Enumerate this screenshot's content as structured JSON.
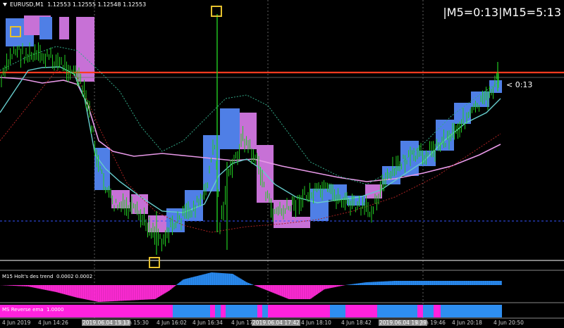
{
  "header": {
    "symbol": "EURUSD,M1",
    "ohlc": "1.12553 1.12555 1.12548 1.12553",
    "timer_text": "|M5=0:13|M15=5:13",
    "price_tag": "< 0:13"
  },
  "indicators": {
    "holt_label": "M15 Holt's des trend",
    "holt_values": "0.0002 0.0002",
    "reverse_label": "MS Reverse ema",
    "reverse_value": "1.0000"
  },
  "time_axis": [
    {
      "label": "4 Jun 2019",
      "highlight": false
    },
    {
      "label": "4 Jun 14:26",
      "highlight": false
    },
    {
      "label": "2019.06.04 15:13",
      "highlight": true
    },
    {
      "label": "4 Jun 15:30",
      "highlight": false
    },
    {
      "label": "4 Jun 16:02",
      "highlight": false
    },
    {
      "label": "4 Jun 16:34",
      "highlight": false
    },
    {
      "label": "4 Jun 17",
      "highlight": false
    },
    {
      "label": "2019.06.04 17:42",
      "highlight": true
    },
    {
      "label": "4 Jun 18:10",
      "highlight": false
    },
    {
      "label": "4 Jun 18:42",
      "highlight": false
    },
    {
      "label": "2019.06.04 19:29",
      "highlight": true
    },
    {
      "label": "4 Jun 19:46",
      "highlight": false
    },
    {
      "label": "4 Jun 20:18",
      "highlight": false
    },
    {
      "label": "4 Jun 20:50",
      "highlight": false
    }
  ],
  "colors": {
    "background": "#000000",
    "candle": "#22cc22",
    "box_up": "#4f7fe6",
    "box_down": "#c771d6",
    "fast_ma": "#66cccc",
    "slow_ma": "#e899e8",
    "red_line": "#ff3b1f",
    "signal_box": "#e6c12e",
    "holt_up": "#2a8bf2",
    "holt_down": "#ff2bd6",
    "reverse_pink": "#ff22dd",
    "reverse_blue": "#2e8ef0"
  },
  "icons": {
    "dropdown": "triangle-down-icon"
  }
}
